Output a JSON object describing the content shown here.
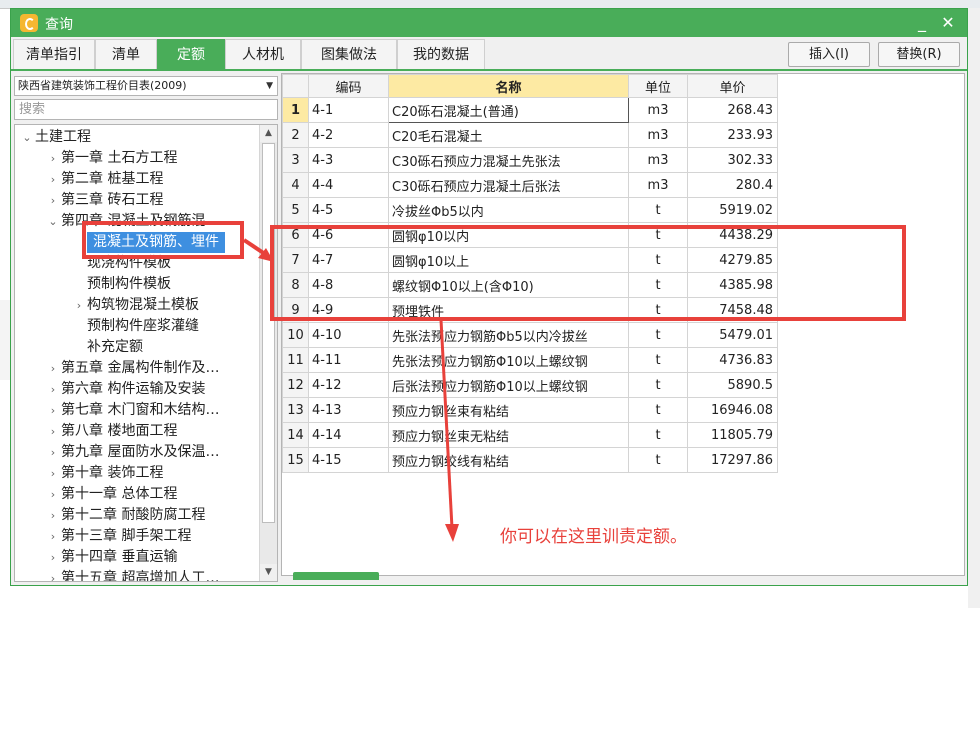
{
  "window": {
    "title": "查询",
    "minimize_glyph": "_",
    "close_glyph": "✕"
  },
  "tabs": [
    {
      "label": "清单指引",
      "active": false
    },
    {
      "label": "清单",
      "active": false
    },
    {
      "label": "定额",
      "active": true
    },
    {
      "label": "人材机",
      "active": false
    },
    {
      "label": "图集做法",
      "active": false
    },
    {
      "label": "我的数据",
      "active": false
    }
  ],
  "buttons": {
    "insert": "插入(I)",
    "replace": "替换(R)"
  },
  "left": {
    "library_select": "陕西省建筑装饰工程价目表(2009)",
    "search_placeholder": "搜索",
    "tree": [
      {
        "label": "土建工程",
        "level": 0,
        "exp": "down"
      },
      {
        "label": "第一章  土石方工程",
        "level": 1,
        "exp": "right"
      },
      {
        "label": "第二章  桩基工程",
        "level": 1,
        "exp": "right"
      },
      {
        "label": "第三章  砖石工程",
        "level": 1,
        "exp": "right"
      },
      {
        "label": "第四章  混凝土及钢筋混",
        "level": 1,
        "exp": "down"
      },
      {
        "label": "混凝土及钢筋、埋件",
        "level": 2,
        "exp": "",
        "selected": true
      },
      {
        "label": "现浇构件模板",
        "level": 2,
        "exp": ""
      },
      {
        "label": "预制构件模板",
        "level": 2,
        "exp": ""
      },
      {
        "label": "构筑物混凝土模板",
        "level": 2,
        "exp": "right"
      },
      {
        "label": "预制构件座浆灌缝",
        "level": 2,
        "exp": ""
      },
      {
        "label": "补充定额",
        "level": 2,
        "exp": ""
      },
      {
        "label": "第五章  金属构件制作及…",
        "level": 1,
        "exp": "right"
      },
      {
        "label": "第六章  构件运输及安装",
        "level": 1,
        "exp": "right"
      },
      {
        "label": "第七章  木门窗和木结构…",
        "level": 1,
        "exp": "right"
      },
      {
        "label": "第八章  楼地面工程",
        "level": 1,
        "exp": "right"
      },
      {
        "label": "第九章  屋面防水及保温…",
        "level": 1,
        "exp": "right"
      },
      {
        "label": "第十章  装饰工程",
        "level": 1,
        "exp": "right"
      },
      {
        "label": "第十一章  总体工程",
        "level": 1,
        "exp": "right"
      },
      {
        "label": "第十二章  耐酸防腐工程",
        "level": 1,
        "exp": "right"
      },
      {
        "label": "第十三章  脚手架工程",
        "level": 1,
        "exp": "right"
      },
      {
        "label": "第十四章  垂直运输",
        "level": 1,
        "exp": "right"
      },
      {
        "label": "第十五章  超高增加人工…",
        "level": 1,
        "exp": "right"
      }
    ]
  },
  "table": {
    "headers": [
      "",
      "编码",
      "名称",
      "单位",
      "单价"
    ],
    "rows": [
      [
        "1",
        "4-1",
        "C20砾石混凝土(普通)",
        "m3",
        "268.43"
      ],
      [
        "2",
        "4-2",
        "C20毛石混凝土",
        "m3",
        "233.93"
      ],
      [
        "3",
        "4-3",
        "C30砾石预应力混凝土先张法",
        "m3",
        "302.33"
      ],
      [
        "4",
        "4-4",
        "C30砾石预应力混凝土后张法",
        "m3",
        "280.4"
      ],
      [
        "5",
        "4-5",
        "冷拔丝Φb5以内",
        "t",
        "5919.02"
      ],
      [
        "6",
        "4-6",
        "圆钢φ10以内",
        "t",
        "4438.29"
      ],
      [
        "7",
        "4-7",
        "圆钢φ10以上",
        "t",
        "4279.85"
      ],
      [
        "8",
        "4-8",
        "螺纹钢Φ10以上(含Φ10)",
        "t",
        "4385.98"
      ],
      [
        "9",
        "4-9",
        "预埋铁件",
        "t",
        "7458.48"
      ],
      [
        "10",
        "4-10",
        "先张法预应力钢筋Φb5以内冷拔丝",
        "t",
        "5479.01"
      ],
      [
        "11",
        "4-11",
        "先张法预应力钢筋Φ10以上螺纹钢",
        "t",
        "4736.83"
      ],
      [
        "12",
        "4-12",
        "后张法预应力钢筋Φ10以上螺纹钢",
        "t",
        "5890.5"
      ],
      [
        "13",
        "4-13",
        "预应力钢丝束有粘结",
        "t",
        "16946.08"
      ],
      [
        "14",
        "4-14",
        "预应力钢丝束无粘结",
        "t",
        "11805.79"
      ],
      [
        "15",
        "4-15",
        "预应力钢绞线有粘结",
        "t",
        "17297.86"
      ]
    ]
  },
  "annotation": "你可以在这里训责定额。",
  "colors": {
    "accent": "#49ad59",
    "annotation_red": "#e8413b",
    "selection": "#3e8fe0",
    "header_highlight": "#fdeaa3"
  }
}
